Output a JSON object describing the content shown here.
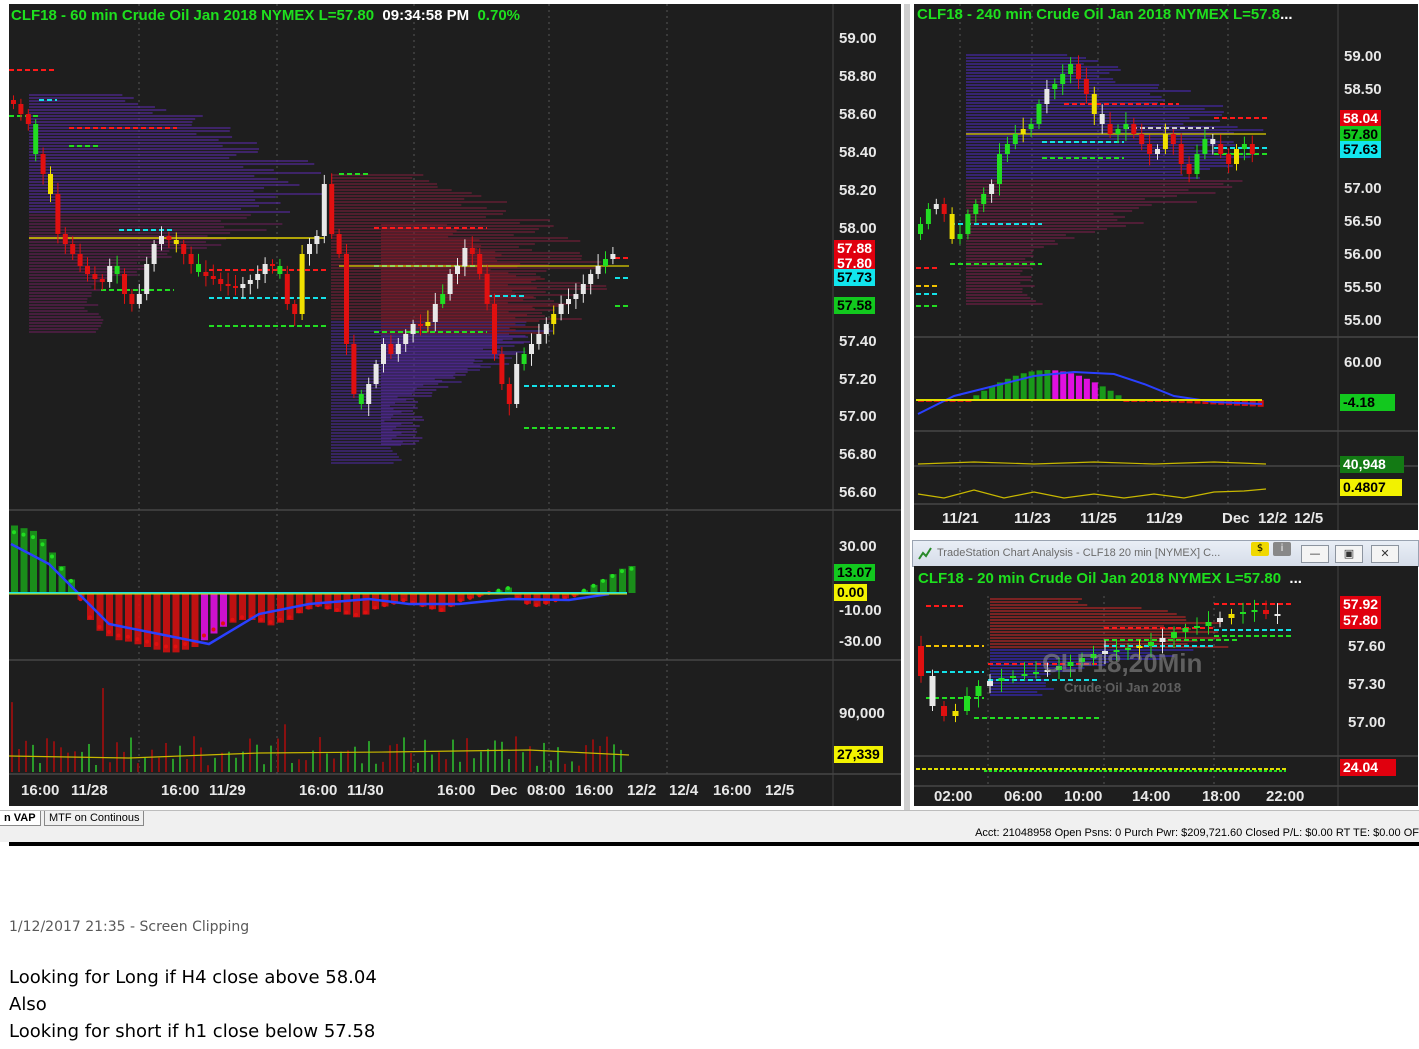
{
  "left_chart": {
    "title": "CLF18 - 60 min  Crude Oil Jan 2018  NYMEX  L=57.80",
    "time": "09:34:58 PM",
    "change": "0.70%",
    "price_axis": [
      "59.00",
      "58.80",
      "58.60",
      "58.40",
      "58.20",
      "58.00",
      "57.40",
      "57.20",
      "57.00",
      "56.80",
      "56.60"
    ],
    "price_tags": [
      {
        "text": "57.88",
        "color": "red"
      },
      {
        "text": "57.80",
        "color": "red"
      },
      {
        "text": "57.73",
        "color": "cyan"
      },
      {
        "text": "57.58",
        "color": "green"
      }
    ],
    "osc_axis": [
      "30.00",
      "-10.00",
      "-30.00"
    ],
    "osc_tags": [
      {
        "text": "13.07",
        "color": "green"
      },
      {
        "text": "0.00",
        "color": "yellow"
      }
    ],
    "vol_axis": [
      "90,000"
    ],
    "vol_tag": {
      "text": "27,339",
      "color": "yellow"
    },
    "time_axis": [
      "16:00",
      "11/28",
      "16:00",
      "11/29",
      "16:00",
      "11/30",
      "16:00",
      "Dec",
      "08:00",
      "16:00",
      "12/2",
      "12/4",
      "16:00",
      "12/5"
    ]
  },
  "right_top_chart": {
    "title": "CLF18 - 240 min  Crude Oil Jan 2018  NYMEX  L=57.8",
    "title_suffix": "...",
    "price_axis": [
      "59.00",
      "58.50",
      "57.00",
      "56.50",
      "56.00",
      "55.50",
      "55.00"
    ],
    "price_tags": [
      {
        "text": "58.04",
        "color": "red"
      },
      {
        "text": "57.80",
        "color": "green"
      },
      {
        "text": "57.63",
        "color": "cyan"
      }
    ],
    "osc_axis": [
      "60.00"
    ],
    "osc_tag": {
      "text": "-4.18",
      "color": "green"
    },
    "vol_tags": [
      {
        "text": "40,948",
        "color": "dkgreen"
      },
      {
        "text": "0.4807",
        "color": "yellow"
      }
    ],
    "time_axis": [
      "11/21",
      "11/23",
      "11/25",
      "11/29",
      "Dec",
      "12/2",
      "12/5"
    ]
  },
  "right_bottom_window": {
    "window_title": "TradeStation Chart Analysis - CLF18 20 min [NYMEX] C...",
    "badge_s": "$",
    "badge_i": "i",
    "minimize": "—",
    "maximize": "▣",
    "close": "✕",
    "title": "CLF18 - 20 min  Crude Oil Jan 2018  NYMEX  L=57.80",
    "title_suffix": "...",
    "watermark": "CLF18,20Min",
    "watermark_sub": "Crude Oil Jan 2018",
    "price_axis": [
      "57.60",
      "57.30",
      "57.00"
    ],
    "price_tags": [
      {
        "text": "57.92",
        "color": "red"
      },
      {
        "text": "57.80",
        "color": "red"
      }
    ],
    "osc_tag": {
      "text": "24.04",
      "color": "red"
    },
    "time_axis": [
      "02:00",
      "06:00",
      "10:00",
      "14:00",
      "18:00",
      "22:00"
    ]
  },
  "tabs": [
    "n VAP",
    "MTF on Continous"
  ],
  "status_bar": "Acct: 21048958  Open Psns: 0  Purch Pwr: $209,721.60  Closed P/L: $0.00  RT TE: $0.00  OF",
  "clipping_caption": "1/12/2017 21:35 - Screen Clipping",
  "notes": [
    "Looking for Long if H4 close above 58.04",
    "Also",
    "Looking for short if h1 close below 57.58"
  ]
}
